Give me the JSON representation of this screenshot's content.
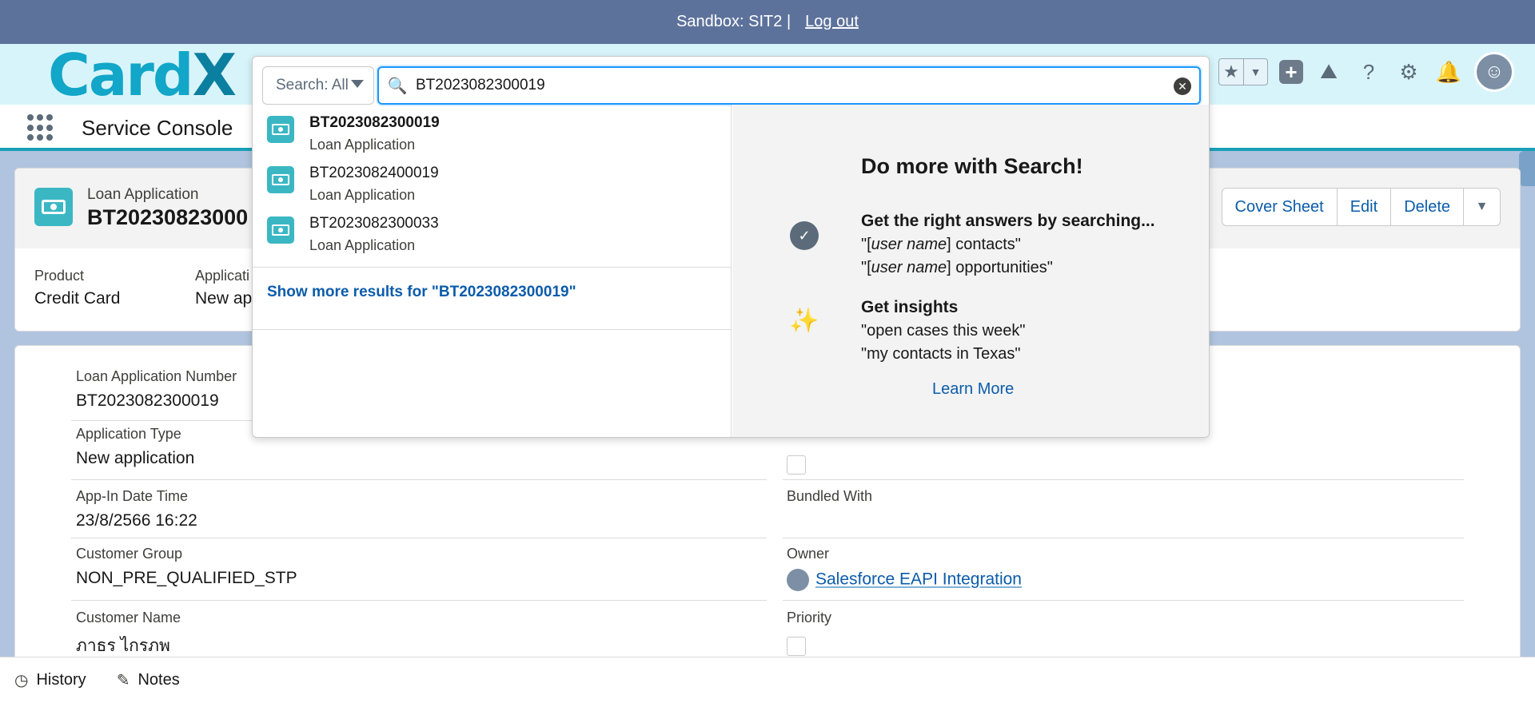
{
  "sandbox": {
    "text": "Sandbox: SIT2 |",
    "logout": "Log out"
  },
  "header": {
    "logo_main": "Card",
    "logo_x": "X"
  },
  "app": {
    "name": "Service Console"
  },
  "record": {
    "type": "Loan Application",
    "title": "BT20230823000",
    "actions": [
      "Cover Sheet",
      "Edit",
      "Delete"
    ],
    "highlights": [
      {
        "label": "Product",
        "value": "Credit Card"
      },
      {
        "label": "Applicati",
        "value": "New ap"
      }
    ]
  },
  "details": {
    "loan_app_number": {
      "label": "Loan Application Number",
      "value": "BT2023082300019"
    },
    "application_type": {
      "label": "Application Type",
      "value": "New application"
    },
    "app_in_date": {
      "label": "App-In Date Time",
      "value": "23/8/2566 16:22"
    },
    "bundled_with": {
      "label": "Bundled With",
      "value": ""
    },
    "customer_group": {
      "label": "Customer Group",
      "value": "NON_PRE_QUALIFIED_STP"
    },
    "owner": {
      "label": "Owner",
      "value": "Salesforce EAPI Integration"
    },
    "customer_name": {
      "label": "Customer Name",
      "value": "ภาธร ไกรภพ"
    },
    "priority": {
      "label": "Priority"
    }
  },
  "search": {
    "scope": "Search: All",
    "query": "BT2023082300019",
    "results": [
      {
        "name": "BT2023082300019",
        "type": "Loan Application"
      },
      {
        "name": "BT2023082400019",
        "type": "Loan Application"
      },
      {
        "name": "BT2023082300033",
        "type": "Loan Application"
      }
    ],
    "show_more": "Show more results for \"BT2023082300019\""
  },
  "tips": {
    "heading": "Do more with Search!",
    "answers_title": "Get the right answers by searching...",
    "answers_1_pre": "\"[",
    "answers_1_em": "user name",
    "answers_1_post": "] contacts\"",
    "answers_2_pre": "\"[",
    "answers_2_em": "user name",
    "answers_2_post": "] opportunities\"",
    "insights_title": "Get insights",
    "insights_1": "\"open cases this week\"",
    "insights_2": "\"my contacts in Texas\"",
    "learn_more": "Learn More"
  },
  "utility": {
    "history": "History",
    "notes": "Notes"
  },
  "icons": {
    "star": "star-icon",
    "plus": "plus-icon",
    "help": "question-icon",
    "gear": "gear-icon",
    "bell": "bell-icon",
    "search": "search-icon"
  },
  "colors": {
    "accent": "#0b5cab",
    "brand": "#12a6c8",
    "record_icon": "#3bb7c4",
    "banner": "#5d729b"
  }
}
